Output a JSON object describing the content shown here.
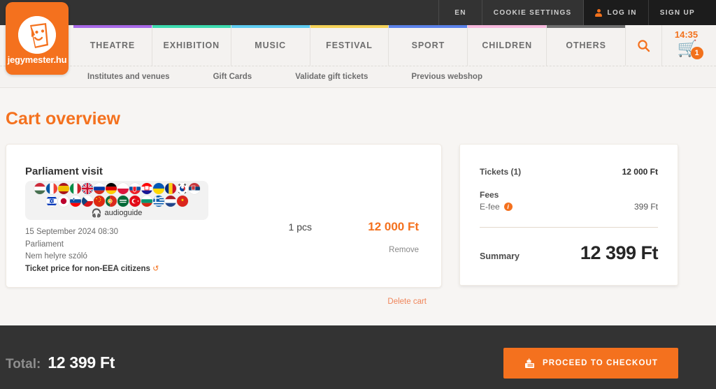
{
  "brand": {
    "name": "jegymester.hu",
    "color": "#f4711e",
    "logo_icon": "theatre-mask-icon"
  },
  "topbar": {
    "language": "EN",
    "cookie_settings": "COOKIE SETTINGS",
    "login": "LOG IN",
    "signup": "SIGN UP"
  },
  "nav": {
    "items": [
      {
        "label": "THEATRE",
        "accent": "#a869e8"
      },
      {
        "label": "EXHIBITION",
        "accent": "#3ddcb0"
      },
      {
        "label": "MUSIC",
        "accent": "#5ecdf2"
      },
      {
        "label": "FESTIVAL",
        "accent": "#f5d257"
      },
      {
        "label": "SPORT",
        "accent": "#5b82ea"
      },
      {
        "label": "CHILDREN",
        "accent": "#f7b8dd"
      },
      {
        "label": "OTHERS",
        "accent": "#6e6e6e"
      }
    ],
    "search_icon": "search-icon",
    "cart_icon": "shopping-cart-icon",
    "cart_timer": "14:35",
    "cart_count": "1"
  },
  "subnav": {
    "items": [
      "Institutes and venues",
      "Gift Cards",
      "Validate gift tickets",
      "Previous webshop"
    ]
  },
  "page": {
    "title": "Cart overview"
  },
  "cart": {
    "item": {
      "title": "Parliament visit",
      "audioguide_label": "audioguide",
      "audioguide_icon": "headphones-icon",
      "languages_row1": [
        "Hungary",
        "France",
        "Spain",
        "Italy",
        "United Kingdom",
        "Russia",
        "Germany",
        "Poland",
        "Slovakia",
        "Croatia",
        "Ukraine",
        "Romania",
        "South Korea",
        "Serbia"
      ],
      "languages_row2": [
        "Israel",
        "Japan",
        "Slovenia",
        "Czechia",
        "China",
        "Portugal",
        "Saudi Arabia",
        "Turkey",
        "Bulgaria",
        "Greece",
        "Netherlands",
        "Vietnam"
      ],
      "date": "15 September 2024 08:30",
      "venue": "Parliament",
      "seating": "Nem helyre szóló",
      "price_category": "Ticket price for non-EEA citizens",
      "price_category_icon": "refresh-icon",
      "quantity": "1 pcs",
      "price": "12 000 Ft",
      "remove_label": "Remove"
    },
    "delete_cart_label": "Delete cart"
  },
  "summary": {
    "tickets_label": "Tickets (1)",
    "tickets_value": "12 000 Ft",
    "fees_label": "Fees",
    "efee_label": "E-fee",
    "efee_info_icon": "info-icon",
    "efee_value": "399 Ft",
    "summary_label": "Summary",
    "summary_value": "12 399 Ft"
  },
  "footer": {
    "total_label": "Total:",
    "total_value": "12 399 Ft",
    "checkout_label": "Proceed to checkout",
    "checkout_icon": "cash-register-icon"
  }
}
